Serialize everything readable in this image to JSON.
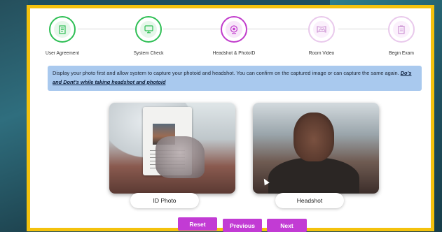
{
  "steps": [
    {
      "label": "User Agreement",
      "icon": "document-icon",
      "state": "done"
    },
    {
      "label": "System Check",
      "icon": "monitor-icon",
      "state": "done"
    },
    {
      "label": "Headshot & PhotoID",
      "icon": "webcam-icon",
      "state": "active"
    },
    {
      "label": "Room Video",
      "icon": "panorama-icon",
      "state": "pending"
    },
    {
      "label": "Begin Exam",
      "icon": "exam-icon",
      "state": "pending"
    }
  ],
  "info": {
    "text": "Display your photo first and allow system to capture your photoid and headshot. You can confirm on the captured image or can capture the same again.",
    "link": "Do's and Dont's while taking headshot and photoid"
  },
  "cards": {
    "id_photo_label": "ID Photo",
    "headshot_label": "Headshot"
  },
  "buttons": {
    "reset": "Reset",
    "previous": "Previous",
    "next": "Next"
  },
  "colors": {
    "frame": "#f4c20d",
    "done": "#2fbf55",
    "active": "#c13ccc",
    "button": "#c23bd4",
    "info_bg": "#a9c9ee"
  }
}
